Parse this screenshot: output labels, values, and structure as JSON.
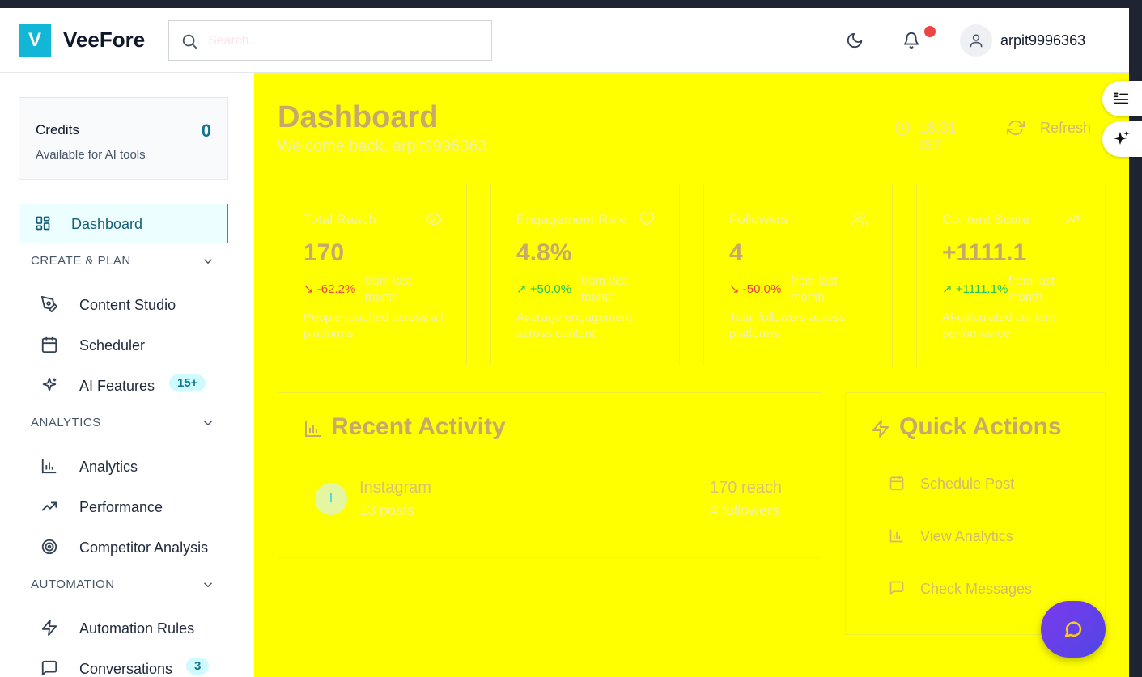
{
  "header": {
    "logo_letter": "V",
    "brand": "VeeFore",
    "search_placeholder": "Search...",
    "username": "arpit9996363"
  },
  "sidebar": {
    "credits": {
      "title": "Credits",
      "value": "0",
      "subtitle": "Available for AI tools"
    },
    "active_item": "Dashboard",
    "sections": [
      {
        "label": "CREATE & PLAN",
        "items": [
          {
            "label": "Content Studio",
            "icon": "pen-tool-icon"
          },
          {
            "label": "Scheduler",
            "icon": "calendar-icon"
          },
          {
            "label": "AI Features",
            "icon": "sparkles-icon",
            "badge": "15+"
          }
        ]
      },
      {
        "label": "ANALYTICS",
        "items": [
          {
            "label": "Analytics",
            "icon": "bar-chart-icon"
          },
          {
            "label": "Performance",
            "icon": "trending-up-icon"
          },
          {
            "label": "Competitor Analysis",
            "icon": "target-icon"
          }
        ]
      },
      {
        "label": "AUTOMATION",
        "items": [
          {
            "label": "Automation Rules",
            "icon": "zap-icon"
          },
          {
            "label": "Conversations",
            "icon": "message-square-icon",
            "badge": "3"
          }
        ]
      }
    ]
  },
  "main": {
    "title": "Dashboard",
    "subtitle": "Welcome back, arpit9996363",
    "time": "18:31 IST",
    "refresh_label": "Refresh",
    "stats": [
      {
        "title": "Total Reach",
        "icon": "eye-icon",
        "value": "170",
        "change": "-62.2%",
        "trend": "down",
        "from": "from last month",
        "desc": "People reached across all platforms"
      },
      {
        "title": "Engagement Rate",
        "icon": "heart-icon",
        "value": "4.8%",
        "change": "+50.0%",
        "trend": "up",
        "from": "from last month",
        "desc": "Average engagement across content"
      },
      {
        "title": "Followers",
        "icon": "users-icon",
        "value": "4",
        "change": "-50.0%",
        "trend": "down",
        "from": "from last month",
        "desc": "Total followers across platforms"
      },
      {
        "title": "Content Score",
        "icon": "trending-up-icon",
        "value": "+1111.1",
        "change": "+1111.1%",
        "trend": "up",
        "from": "from last month",
        "desc": "AI-calculated content performance"
      }
    ],
    "recent_activity": {
      "title": "Recent Activity",
      "items": [
        {
          "initial": "I",
          "platform": "Instagram",
          "posts": "13 posts",
          "reach": "170 reach",
          "followers": "4 followers"
        }
      ]
    },
    "quick_actions": {
      "title": "Quick Actions",
      "items": [
        {
          "label": "Schedule Post",
          "icon": "calendar-icon"
        },
        {
          "label": "View Analytics",
          "icon": "bar-chart-icon"
        },
        {
          "label": "Check Messages",
          "icon": "message-square-icon"
        }
      ]
    }
  },
  "colors": {
    "brand": "#12b6d6",
    "main_bg": "#ffff00",
    "negative": "#ef4444",
    "positive": "#22c55e",
    "notification": "#ef4444"
  }
}
